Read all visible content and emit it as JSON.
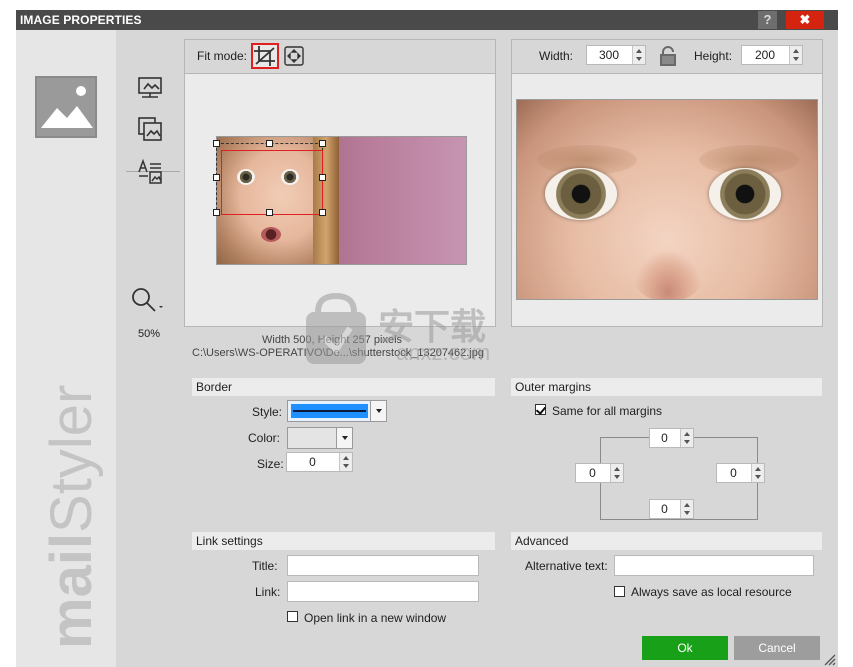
{
  "window": {
    "title": "IMAGE PROPERTIES",
    "help_label": "?",
    "close_label": "✖"
  },
  "brand": {
    "prefix": "mail",
    "suffix": "Styler"
  },
  "toolbar": {
    "zoom_label": "50%"
  },
  "source_panel": {
    "fit_mode_label": "Fit mode:",
    "image_info": "Width  500, Height  257 pixels",
    "image_path": "C:\\Users\\WS-OPERATIVO\\De...\\shutterstock_13207462.jpg"
  },
  "output_panel": {
    "width_label": "Width:",
    "width_value": "300",
    "height_label": "Height:",
    "height_value": "200"
  },
  "border": {
    "header": "Border",
    "style_label": "Style:",
    "color_label": "Color:",
    "size_label": "Size:",
    "size_value": "0",
    "style_color": "#1e90ff"
  },
  "outer_margins": {
    "header": "Outer margins",
    "same_label": "Same for all margins",
    "top": "0",
    "left": "0",
    "right": "0",
    "bottom": "0"
  },
  "link_settings": {
    "header": "Link settings",
    "title_label": "Title:",
    "title_value": "",
    "link_label": "Link:",
    "link_value": "",
    "new_window_label": "Open link in a new window"
  },
  "advanced": {
    "header": "Advanced",
    "alt_label": "Alternative text:",
    "alt_value": "",
    "local_label": "Always save as local resource"
  },
  "footer": {
    "ok_label": "Ok",
    "cancel_label": "Cancel"
  },
  "watermark": {
    "text": "安下载",
    "sub": "anxz.com"
  }
}
